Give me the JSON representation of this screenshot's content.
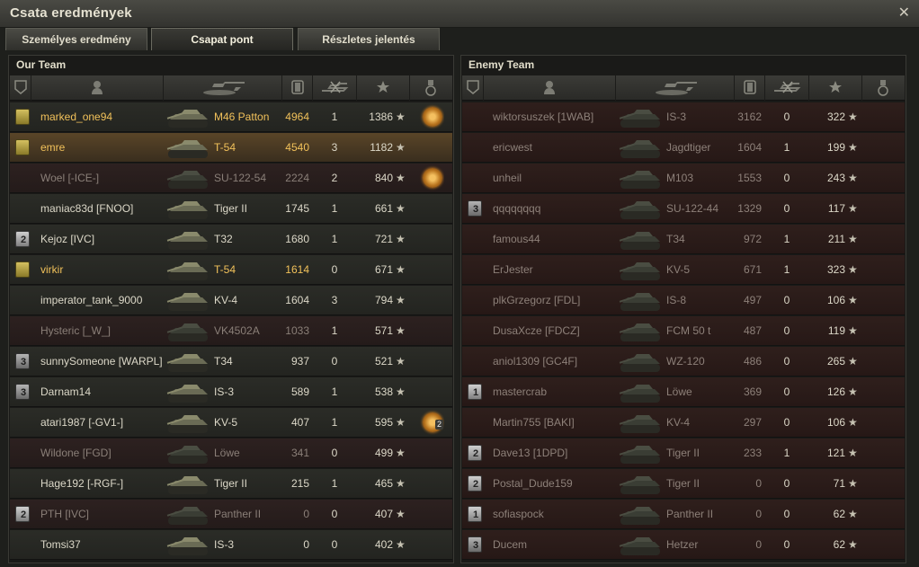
{
  "window": {
    "title": "Csata eredmények",
    "close_glyph": "✕"
  },
  "tabs": [
    {
      "label": "Személyes eredmény"
    },
    {
      "label": "Csapat pont",
      "active": true
    },
    {
      "label": "Részletes jelentés"
    }
  ],
  "columns": [
    "badge-icon",
    "player-icon",
    "tank-icon",
    "damage-icon",
    "kills-icon",
    "xp-star-icon",
    "medal-icon"
  ],
  "our_team": {
    "title": "Our Team",
    "rows": [
      {
        "badge": "gold",
        "badge_num": "",
        "name": "marked_one94",
        "vehicle": "M46 Patton",
        "damage": "4964",
        "kills": "1",
        "xp": "1386",
        "medal": true,
        "state": "gold-alive"
      },
      {
        "badge": "gold",
        "badge_num": "",
        "name": "emre",
        "vehicle": "T-54",
        "damage": "4540",
        "kills": "3",
        "xp": "1182",
        "medal": false,
        "state": "highlight"
      },
      {
        "badge": "",
        "badge_num": "",
        "name": "Woel [-ICE-]",
        "vehicle": "SU-122-54",
        "damage": "2224",
        "kills": "2",
        "xp": "840",
        "medal": true,
        "state": "dead"
      },
      {
        "badge": "",
        "badge_num": "",
        "name": "maniac83d [FNOO]",
        "vehicle": "Tiger II",
        "damage": "1745",
        "kills": "1",
        "xp": "661",
        "medal": false,
        "state": "alive"
      },
      {
        "badge": "silver",
        "badge_num": "2",
        "name": "Kejoz [IVC]",
        "vehicle": "T32",
        "damage": "1680",
        "kills": "1",
        "xp": "721",
        "medal": false,
        "state": "alive"
      },
      {
        "badge": "gold",
        "badge_num": "",
        "name": "virkir",
        "vehicle": "T-54",
        "damage": "1614",
        "kills": "0",
        "xp": "671",
        "medal": false,
        "state": "gold-alive"
      },
      {
        "badge": "",
        "badge_num": "",
        "name": "imperator_tank_9000",
        "vehicle": "KV-4",
        "damage": "1604",
        "kills": "3",
        "xp": "794",
        "medal": false,
        "state": "alive"
      },
      {
        "badge": "",
        "badge_num": "",
        "name": "Hysteric [_W_]",
        "vehicle": "VK4502A",
        "damage": "1033",
        "kills": "1",
        "xp": "571",
        "medal": false,
        "state": "dead"
      },
      {
        "badge": "bronze",
        "badge_num": "3",
        "name": "sunnySomeone [WARPL]",
        "vehicle": "T34",
        "damage": "937",
        "kills": "0",
        "xp": "521",
        "medal": false,
        "state": "alive"
      },
      {
        "badge": "bronze",
        "badge_num": "3",
        "name": "Darnam14",
        "vehicle": "IS-3",
        "damage": "589",
        "kills": "1",
        "xp": "538",
        "medal": false,
        "state": "alive"
      },
      {
        "badge": "",
        "badge_num": "",
        "name": "atari1987 [-GV1-]",
        "vehicle": "KV-5",
        "damage": "407",
        "kills": "1",
        "xp": "595",
        "medal": true,
        "medal_count": "2",
        "state": "alive"
      },
      {
        "badge": "",
        "badge_num": "",
        "name": "Wildone [FGD]",
        "vehicle": "Löwe",
        "damage": "341",
        "kills": "0",
        "xp": "499",
        "medal": false,
        "state": "dead"
      },
      {
        "badge": "",
        "badge_num": "",
        "name": "Hage192 [-RGF-]",
        "vehicle": "Tiger II",
        "damage": "215",
        "kills": "1",
        "xp": "465",
        "medal": false,
        "state": "alive"
      },
      {
        "badge": "silver",
        "badge_num": "2",
        "name": "PTH [IVC]",
        "vehicle": "Panther II",
        "damage": "0",
        "kills": "0",
        "xp": "407",
        "medal": false,
        "state": "dead"
      },
      {
        "badge": "",
        "badge_num": "",
        "name": "Tomsi37",
        "vehicle": "IS-3",
        "damage": "0",
        "kills": "0",
        "xp": "402",
        "medal": false,
        "state": "alive"
      }
    ]
  },
  "enemy_team": {
    "title": "Enemy Team",
    "rows": [
      {
        "badge": "",
        "badge_num": "",
        "name": "wiktorsuszek [1WAB]",
        "vehicle": "IS-3",
        "damage": "3162",
        "kills": "0",
        "xp": "322",
        "medal": false,
        "state": "edead"
      },
      {
        "badge": "",
        "badge_num": "",
        "name": "ericwest",
        "vehicle": "Jagdtiger",
        "damage": "1604",
        "kills": "1",
        "xp": "199",
        "medal": false,
        "state": "edead"
      },
      {
        "badge": "",
        "badge_num": "",
        "name": "unheil",
        "vehicle": "M103",
        "damage": "1553",
        "kills": "0",
        "xp": "243",
        "medal": false,
        "state": "edead"
      },
      {
        "badge": "bronze",
        "badge_num": "3",
        "name": "qqqqqqqq",
        "vehicle": "SU-122-44",
        "damage": "1329",
        "kills": "0",
        "xp": "117",
        "medal": false,
        "state": "edead"
      },
      {
        "badge": "",
        "badge_num": "",
        "name": "famous44",
        "vehicle": "T34",
        "damage": "972",
        "kills": "1",
        "xp": "211",
        "medal": false,
        "state": "edead"
      },
      {
        "badge": "",
        "badge_num": "",
        "name": "ErJester",
        "vehicle": "KV-5",
        "damage": "671",
        "kills": "1",
        "xp": "323",
        "medal": false,
        "state": "edead"
      },
      {
        "badge": "",
        "badge_num": "",
        "name": "plkGrzegorz [FDL]",
        "vehicle": "IS-8",
        "damage": "497",
        "kills": "0",
        "xp": "106",
        "medal": false,
        "state": "edead"
      },
      {
        "badge": "",
        "badge_num": "",
        "name": "DusaXcze [FDCZ]",
        "vehicle": "FCM 50 t",
        "damage": "487",
        "kills": "0",
        "xp": "119",
        "medal": false,
        "state": "edead"
      },
      {
        "badge": "",
        "badge_num": "",
        "name": "aniol1309 [GC4F]",
        "vehicle": "WZ-120",
        "damage": "486",
        "kills": "0",
        "xp": "265",
        "medal": false,
        "state": "edead"
      },
      {
        "badge": "silver",
        "badge_num": "1",
        "name": "mastercrab",
        "vehicle": "Löwe",
        "damage": "369",
        "kills": "0",
        "xp": "126",
        "medal": false,
        "state": "edead"
      },
      {
        "badge": "",
        "badge_num": "",
        "name": "Martin755 [BAKI]",
        "vehicle": "KV-4",
        "damage": "297",
        "kills": "0",
        "xp": "106",
        "medal": false,
        "state": "edead"
      },
      {
        "badge": "silver",
        "badge_num": "2",
        "name": "Dave13 [1DPD]",
        "vehicle": "Tiger II",
        "damage": "233",
        "kills": "1",
        "xp": "121",
        "medal": false,
        "state": "edead"
      },
      {
        "badge": "silver",
        "badge_num": "2",
        "name": "Postal_Dude159",
        "vehicle": "Tiger II",
        "damage": "0",
        "kills": "0",
        "xp": "71",
        "medal": false,
        "state": "edead"
      },
      {
        "badge": "silver",
        "badge_num": "1",
        "name": "sofiaspock",
        "vehicle": "Panther II",
        "damage": "0",
        "kills": "0",
        "xp": "62",
        "medal": false,
        "state": "edead"
      },
      {
        "badge": "bronze",
        "badge_num": "3",
        "name": "Ducem",
        "vehicle": "Hetzer",
        "damage": "0",
        "kills": "0",
        "xp": "62",
        "medal": false,
        "state": "edead"
      }
    ]
  },
  "star_glyph": "★"
}
